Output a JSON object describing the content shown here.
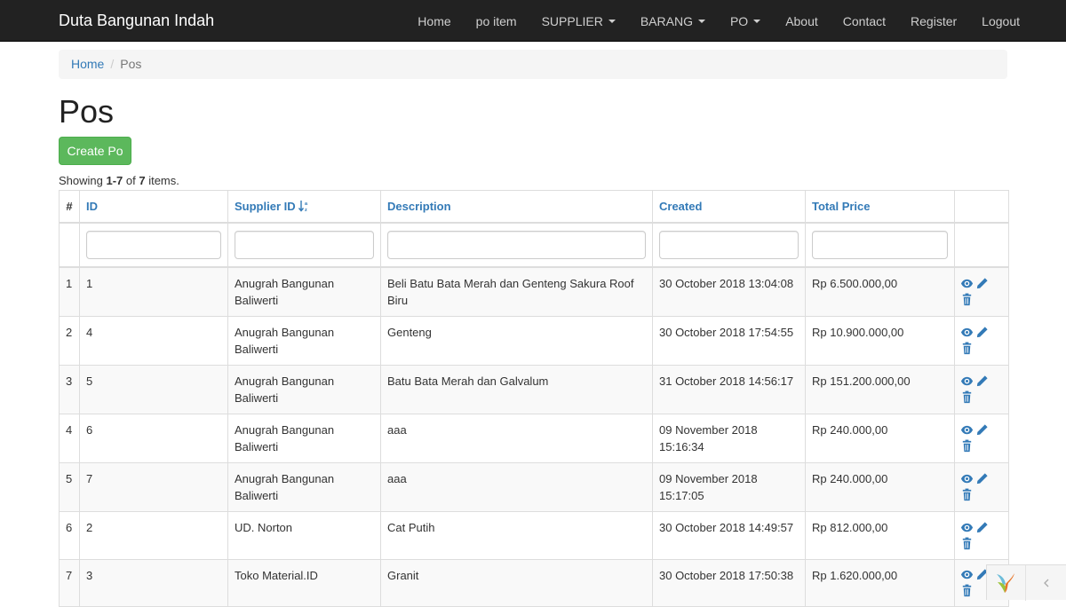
{
  "navbar": {
    "brand": "Duta Bangunan Indah",
    "items": [
      {
        "label": "Home",
        "dropdown": false
      },
      {
        "label": "po item",
        "dropdown": false
      },
      {
        "label": "SUPPLIER",
        "dropdown": true
      },
      {
        "label": "BARANG",
        "dropdown": true
      },
      {
        "label": "PO",
        "dropdown": true
      },
      {
        "label": "About",
        "dropdown": false
      },
      {
        "label": "Contact",
        "dropdown": false
      },
      {
        "label": "Register",
        "dropdown": false
      },
      {
        "label": "Logout",
        "dropdown": false
      }
    ]
  },
  "breadcrumb": {
    "home": "Home",
    "separator": "/",
    "current": "Pos"
  },
  "page": {
    "title": "Pos",
    "create_button": "Create Po",
    "summary": {
      "prefix": "Showing ",
      "range": "1-7",
      "middle": " of ",
      "total": "7",
      "suffix": " items."
    }
  },
  "table": {
    "headers": {
      "hash": "#",
      "id": "ID",
      "supplier_id": "Supplier ID",
      "description": "Description",
      "created": "Created",
      "total_price": "Total Price"
    },
    "sorted_column": "supplier_id",
    "rows": [
      {
        "num": "1",
        "id": "1",
        "supplier": "Anugrah Bangunan Baliwerti",
        "description": "Beli Batu Bata Merah dan Genteng Sakura Roof Biru",
        "created": "30 October 2018 13:04:08",
        "total_price": "Rp 6.500.000,00"
      },
      {
        "num": "2",
        "id": "4",
        "supplier": "Anugrah Bangunan Baliwerti",
        "description": "Genteng",
        "created": "30 October 2018 17:54:55",
        "total_price": "Rp 10.900.000,00"
      },
      {
        "num": "3",
        "id": "5",
        "supplier": "Anugrah Bangunan Baliwerti",
        "description": "Batu Bata Merah dan Galvalum",
        "created": "31 October 2018 14:56:17",
        "total_price": "Rp 151.200.000,00"
      },
      {
        "num": "4",
        "id": "6",
        "supplier": "Anugrah Bangunan Baliwerti",
        "description": "aaa",
        "created": "09 November 2018 15:16:34",
        "total_price": "Rp 240.000,00"
      },
      {
        "num": "5",
        "id": "7",
        "supplier": "Anugrah Bangunan Baliwerti",
        "description": "aaa",
        "created": "09 November 2018 15:17:05",
        "total_price": "Rp 240.000,00"
      },
      {
        "num": "6",
        "id": "2",
        "supplier": "UD. Norton",
        "description": "Cat Putih",
        "created": "30 October 2018 14:49:57",
        "total_price": "Rp 812.000,00"
      },
      {
        "num": "7",
        "id": "3",
        "supplier": "Toko Material.ID",
        "description": "Granit",
        "created": "30 October 2018 17:50:38",
        "total_price": "Rp 1.620.000,00"
      }
    ],
    "row_actions": [
      "eye-icon",
      "pencil-icon",
      "trash-icon"
    ]
  },
  "colors": {
    "navbar_bg": "#222222",
    "link": "#337ab7",
    "success": "#5cb85c",
    "stripe": "#f9f9f9"
  }
}
